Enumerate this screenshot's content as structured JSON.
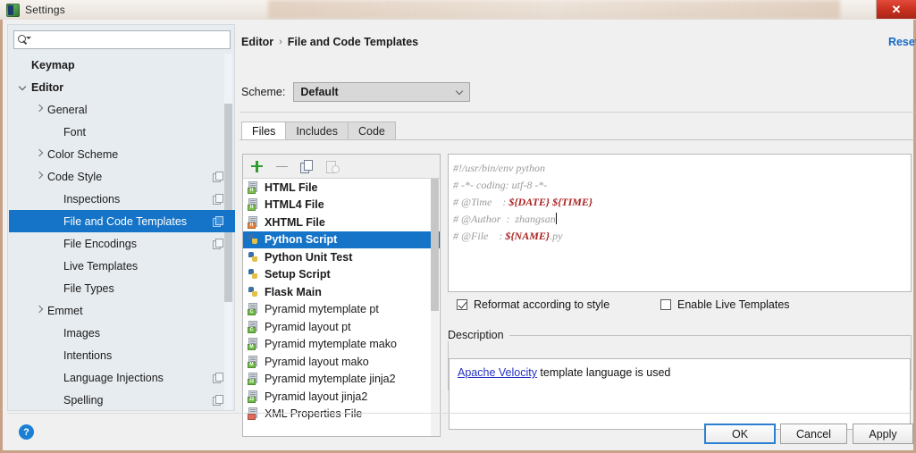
{
  "window": {
    "title": "Settings",
    "app_icon": "pycharm-icon",
    "close_label": "✕"
  },
  "sidebar": {
    "search": {
      "value": "",
      "placeholder": "",
      "icon": "search-icon"
    },
    "items": [
      {
        "label": "Keymap",
        "indent": 0,
        "arrow": "none",
        "bold": true,
        "copy": false,
        "selected": false
      },
      {
        "label": "Editor",
        "indent": 0,
        "arrow": "expanded",
        "bold": true,
        "copy": false,
        "selected": false
      },
      {
        "label": "General",
        "indent": 1,
        "arrow": "collapsed",
        "bold": false,
        "copy": false,
        "selected": false
      },
      {
        "label": "Font",
        "indent": 2,
        "arrow": "none",
        "bold": false,
        "copy": false,
        "selected": false
      },
      {
        "label": "Color Scheme",
        "indent": 1,
        "arrow": "collapsed",
        "bold": false,
        "copy": false,
        "selected": false
      },
      {
        "label": "Code Style",
        "indent": 1,
        "arrow": "collapsed",
        "bold": false,
        "copy": true,
        "selected": false
      },
      {
        "label": "Inspections",
        "indent": 2,
        "arrow": "none",
        "bold": false,
        "copy": true,
        "selected": false
      },
      {
        "label": "File and Code Templates",
        "indent": 2,
        "arrow": "none",
        "bold": false,
        "copy": true,
        "selected": true
      },
      {
        "label": "File Encodings",
        "indent": 2,
        "arrow": "none",
        "bold": false,
        "copy": true,
        "selected": false
      },
      {
        "label": "Live Templates",
        "indent": 2,
        "arrow": "none",
        "bold": false,
        "copy": false,
        "selected": false
      },
      {
        "label": "File Types",
        "indent": 2,
        "arrow": "none",
        "bold": false,
        "copy": false,
        "selected": false
      },
      {
        "label": "Emmet",
        "indent": 1,
        "arrow": "collapsed",
        "bold": false,
        "copy": false,
        "selected": false
      },
      {
        "label": "Images",
        "indent": 2,
        "arrow": "none",
        "bold": false,
        "copy": false,
        "selected": false
      },
      {
        "label": "Intentions",
        "indent": 2,
        "arrow": "none",
        "bold": false,
        "copy": false,
        "selected": false
      },
      {
        "label": "Language Injections",
        "indent": 2,
        "arrow": "none",
        "bold": false,
        "copy": true,
        "selected": false
      },
      {
        "label": "Spelling",
        "indent": 2,
        "arrow": "none",
        "bold": false,
        "copy": true,
        "selected": false
      }
    ]
  },
  "content": {
    "breadcrumb": {
      "parent": "Editor",
      "separator": "›",
      "current": "File and Code Templates"
    },
    "reset_label": "Reset",
    "scheme": {
      "label": "Scheme:",
      "value": "Default"
    },
    "tabs": [
      {
        "label": "Files",
        "active": true
      },
      {
        "label": "Includes",
        "active": false
      },
      {
        "label": "Code",
        "active": false
      }
    ],
    "toolbar": {
      "add": "+",
      "remove": "−",
      "copy": "copy",
      "revert": "revert"
    },
    "files": [
      {
        "label": "HTML File",
        "icon": "html-file-icon",
        "badge": "H",
        "badge_class": "badge-h",
        "bold": true,
        "selected": false
      },
      {
        "label": "HTML4 File",
        "icon": "html-file-icon",
        "badge": "H",
        "badge_class": "badge-h",
        "bold": true,
        "selected": false
      },
      {
        "label": "XHTML File",
        "icon": "xhtml-file-icon",
        "badge": "H",
        "badge_class": "badge-x",
        "bold": true,
        "selected": false
      },
      {
        "label": "Python Script",
        "icon": "python-file-icon",
        "badge": "",
        "badge_class": "",
        "bold": true,
        "selected": true
      },
      {
        "label": "Python Unit Test",
        "icon": "python-file-icon",
        "badge": "",
        "badge_class": "",
        "bold": true,
        "selected": false
      },
      {
        "label": "Setup Script",
        "icon": "python-file-icon",
        "badge": "",
        "badge_class": "",
        "bold": true,
        "selected": false
      },
      {
        "label": "Flask Main",
        "icon": "python-file-icon",
        "badge": "",
        "badge_class": "",
        "bold": true,
        "selected": false
      },
      {
        "label": "Pyramid mytemplate pt",
        "icon": "template-file-icon",
        "badge": "C",
        "badge_class": "badge-c",
        "bold": false,
        "selected": false
      },
      {
        "label": "Pyramid layout pt",
        "icon": "template-file-icon",
        "badge": "C",
        "badge_class": "badge-c",
        "bold": false,
        "selected": false
      },
      {
        "label": "Pyramid mytemplate mako",
        "icon": "template-file-icon",
        "badge": "M",
        "badge_class": "badge-m",
        "bold": false,
        "selected": false
      },
      {
        "label": "Pyramid layout mako",
        "icon": "template-file-icon",
        "badge": "M",
        "badge_class": "badge-m",
        "bold": false,
        "selected": false
      },
      {
        "label": "Pyramid mytemplate jinja2",
        "icon": "template-file-icon",
        "badge": "J2",
        "badge_class": "badge-j",
        "bold": false,
        "selected": false
      },
      {
        "label": "Pyramid layout jinja2",
        "icon": "template-file-icon",
        "badge": "J2",
        "badge_class": "badge-j",
        "bold": false,
        "selected": false
      },
      {
        "label": "XML Properties File",
        "icon": "xml-file-icon",
        "badge": "<?",
        "badge_class": "badge-q",
        "bold": false,
        "selected": false
      }
    ],
    "editor": {
      "lines": [
        {
          "text": "#!/usr/bin/env python",
          "var": "",
          "tail": ""
        },
        {
          "text": "# -*- coding: utf-8 -*-",
          "var": "",
          "tail": ""
        },
        {
          "text": "# @Time    : ",
          "var": "${DATE} ${TIME}",
          "tail": ""
        },
        {
          "text": "# @Author  :  zhangsan",
          "var": "",
          "tail": "",
          "caret": true
        },
        {
          "text": "# @File    : ",
          "var": "${NAME}",
          "tail": ".py"
        }
      ]
    },
    "options": {
      "reformat": {
        "label": "Reformat according to style",
        "checked": true,
        "mnemonic": "R"
      },
      "live_templates": {
        "label": "Enable Live Templates",
        "checked": false,
        "mnemonic": "L"
      }
    },
    "description": {
      "label": "Description",
      "link_text": "Apache Velocity",
      "body_text": " template language is used"
    }
  },
  "footer": {
    "help": "?",
    "ok": "OK",
    "cancel": "Cancel",
    "apply": "Apply"
  },
  "colors": {
    "selection": "#1574c8",
    "link": "#1569c7",
    "variable": "#aa2222",
    "close": "#c9301f"
  }
}
